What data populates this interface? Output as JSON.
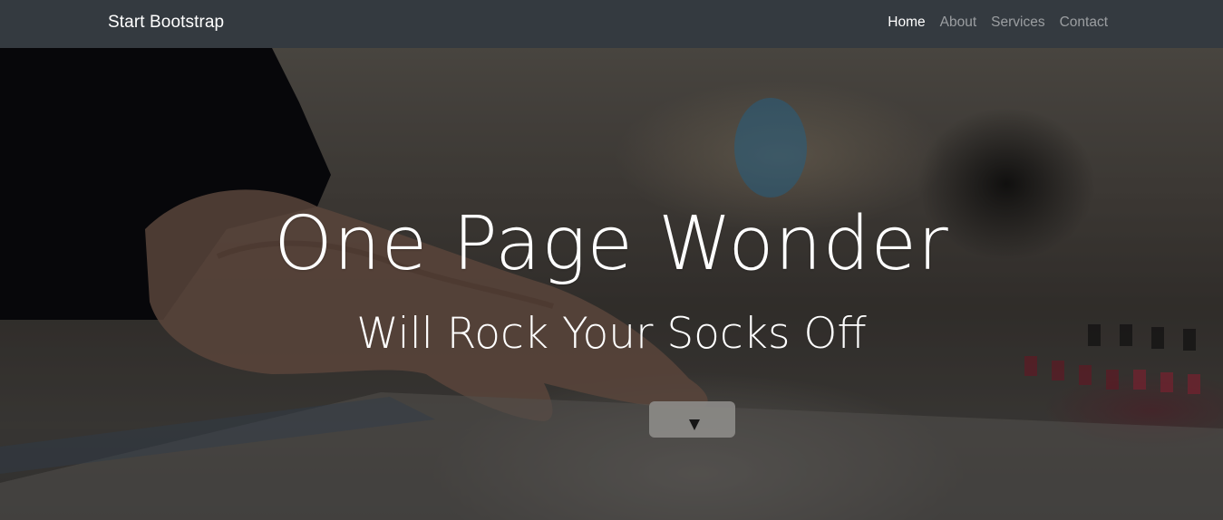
{
  "navbar": {
    "brand": "Start Bootstrap",
    "links": [
      {
        "label": "Home",
        "active": true
      },
      {
        "label": "About",
        "active": false
      },
      {
        "label": "Services",
        "active": false
      },
      {
        "label": "Contact",
        "active": false
      }
    ]
  },
  "hero": {
    "title": "One Page Wonder",
    "subtitle": "Will Rock Your Socks Off"
  }
}
